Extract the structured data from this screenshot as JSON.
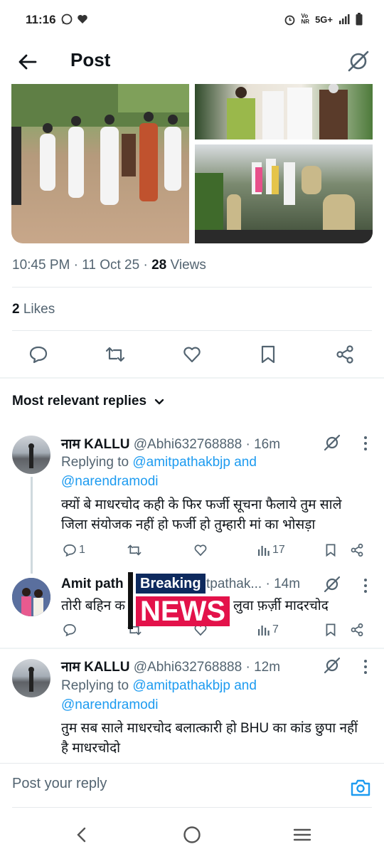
{
  "status_bar": {
    "time": "11:16",
    "network": "5G+",
    "icons": [
      "whatsapp-icon",
      "heart-icon",
      "alarm-icon",
      "volte-icon",
      "signal-icon",
      "battery-icon"
    ]
  },
  "header": {
    "title": "Post",
    "back_icon": "back-arrow-icon",
    "right_icon": "grok-icon"
  },
  "post": {
    "time": "10:45 PM",
    "date": "11 Oct 25",
    "views_count": "28",
    "views_label": "Views",
    "likes_count": "2",
    "likes_label": "Likes",
    "media_count": 3
  },
  "post_actions": [
    "reply-icon",
    "retweet-icon",
    "like-icon",
    "bookmark-icon",
    "share-icon"
  ],
  "replies_sort": {
    "label": "Most relevant replies"
  },
  "replies": [
    {
      "name": "नाम KALLU",
      "handle": "@Abhi632768888",
      "time": "16m",
      "replying_prefix": "Replying to",
      "replying_to_1": "@amitpathakbjp",
      "replying_and": "and",
      "replying_to_2": "@narendramodi",
      "text": "क्यों बे माधरचोद कही के फिर फर्जी सूचना फैलाये तुम साले जिला संयोजक नहीं हो फर्जी हो तुम्हारी मां का भोसड़ा",
      "reply_count": "1",
      "views": "17"
    },
    {
      "name": "Amit path",
      "handle": "tpathak...",
      "time": "14m",
      "text_left": "तोरी बहिन क",
      "text_right": "लुवा फ़र्ज़ी मादरचोद",
      "views": "7",
      "overlay_top": "Breaking",
      "overlay_bottom": "NEWS"
    },
    {
      "name": "नाम KALLU",
      "handle": "@Abhi632768888",
      "time": "12m",
      "replying_prefix": "Replying to",
      "replying_to_1": "@amitpathakbjp",
      "replying_and": "and",
      "replying_to_2": "@narendramodi",
      "text": "तुम सब साले माधरचोद बलात्कारी हो BHU का कांड छुपा नहीं है माधरचोदो"
    }
  ],
  "compose": {
    "placeholder": "Post your reply"
  },
  "nav": [
    "nav-back-icon",
    "nav-home-icon",
    "nav-recents-icon"
  ],
  "colors": {
    "link": "#1d9bf0",
    "muted": "#536471",
    "text": "#0f1419",
    "divider": "#eff3f4",
    "breaking_red": "#e3124a"
  }
}
